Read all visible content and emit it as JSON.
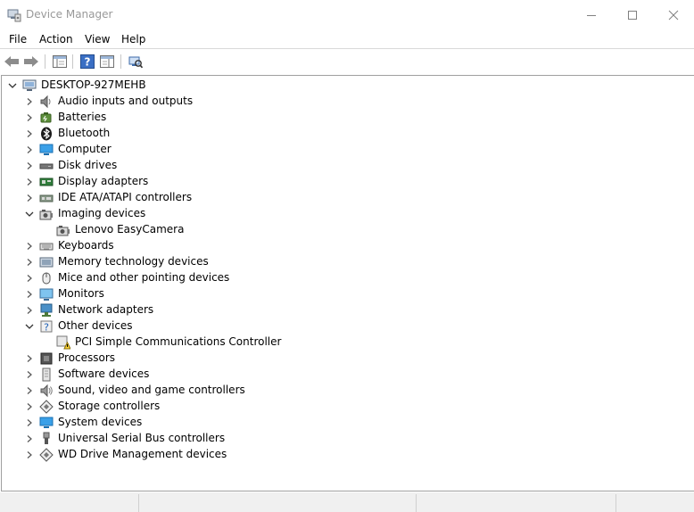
{
  "window": {
    "title": "Device Manager"
  },
  "menu": [
    "File",
    "Action",
    "View",
    "Help"
  ],
  "tree": {
    "root": "DESKTOP-927MEHB",
    "categories": [
      {
        "label": "Audio inputs and outputs",
        "icon": "speaker-icon",
        "expanded": false
      },
      {
        "label": "Batteries",
        "icon": "battery-icon",
        "expanded": false
      },
      {
        "label": "Bluetooth",
        "icon": "bluetooth-icon",
        "expanded": false
      },
      {
        "label": "Computer",
        "icon": "computer-icon",
        "expanded": false
      },
      {
        "label": "Disk drives",
        "icon": "disk-drive-icon",
        "expanded": false
      },
      {
        "label": "Display adapters",
        "icon": "display-adapter-icon",
        "expanded": false
      },
      {
        "label": "IDE ATA/ATAPI controllers",
        "icon": "ide-controller-icon",
        "expanded": false
      },
      {
        "label": "Imaging devices",
        "icon": "camera-icon",
        "expanded": true,
        "children": [
          {
            "label": "Lenovo EasyCamera",
            "icon": "camera-icon"
          }
        ]
      },
      {
        "label": "Keyboards",
        "icon": "keyboard-icon",
        "expanded": false
      },
      {
        "label": "Memory technology devices",
        "icon": "memory-device-icon",
        "expanded": false
      },
      {
        "label": "Mice and other pointing devices",
        "icon": "mouse-icon",
        "expanded": false
      },
      {
        "label": "Monitors",
        "icon": "monitor-icon",
        "expanded": false
      },
      {
        "label": "Network adapters",
        "icon": "network-adapter-icon",
        "expanded": false
      },
      {
        "label": "Other devices",
        "icon": "unknown-device-icon",
        "expanded": true,
        "children": [
          {
            "label": "PCI Simple Communications Controller",
            "icon": "warning-device-icon"
          }
        ]
      },
      {
        "label": "Processors",
        "icon": "processor-icon",
        "expanded": false
      },
      {
        "label": "Software devices",
        "icon": "software-device-icon",
        "expanded": false
      },
      {
        "label": "Sound, video and game controllers",
        "icon": "sound-controller-icon",
        "expanded": false
      },
      {
        "label": "Storage controllers",
        "icon": "storage-controller-icon",
        "expanded": false
      },
      {
        "label": "System devices",
        "icon": "system-device-icon",
        "expanded": false
      },
      {
        "label": "Universal Serial Bus controllers",
        "icon": "usb-icon",
        "expanded": false
      },
      {
        "label": "WD Drive Management devices",
        "icon": "wd-drive-icon",
        "expanded": false
      }
    ]
  },
  "colors": {
    "title_inactive": "#999999",
    "accent": "#0078d7",
    "warning": "#f7d23b"
  }
}
